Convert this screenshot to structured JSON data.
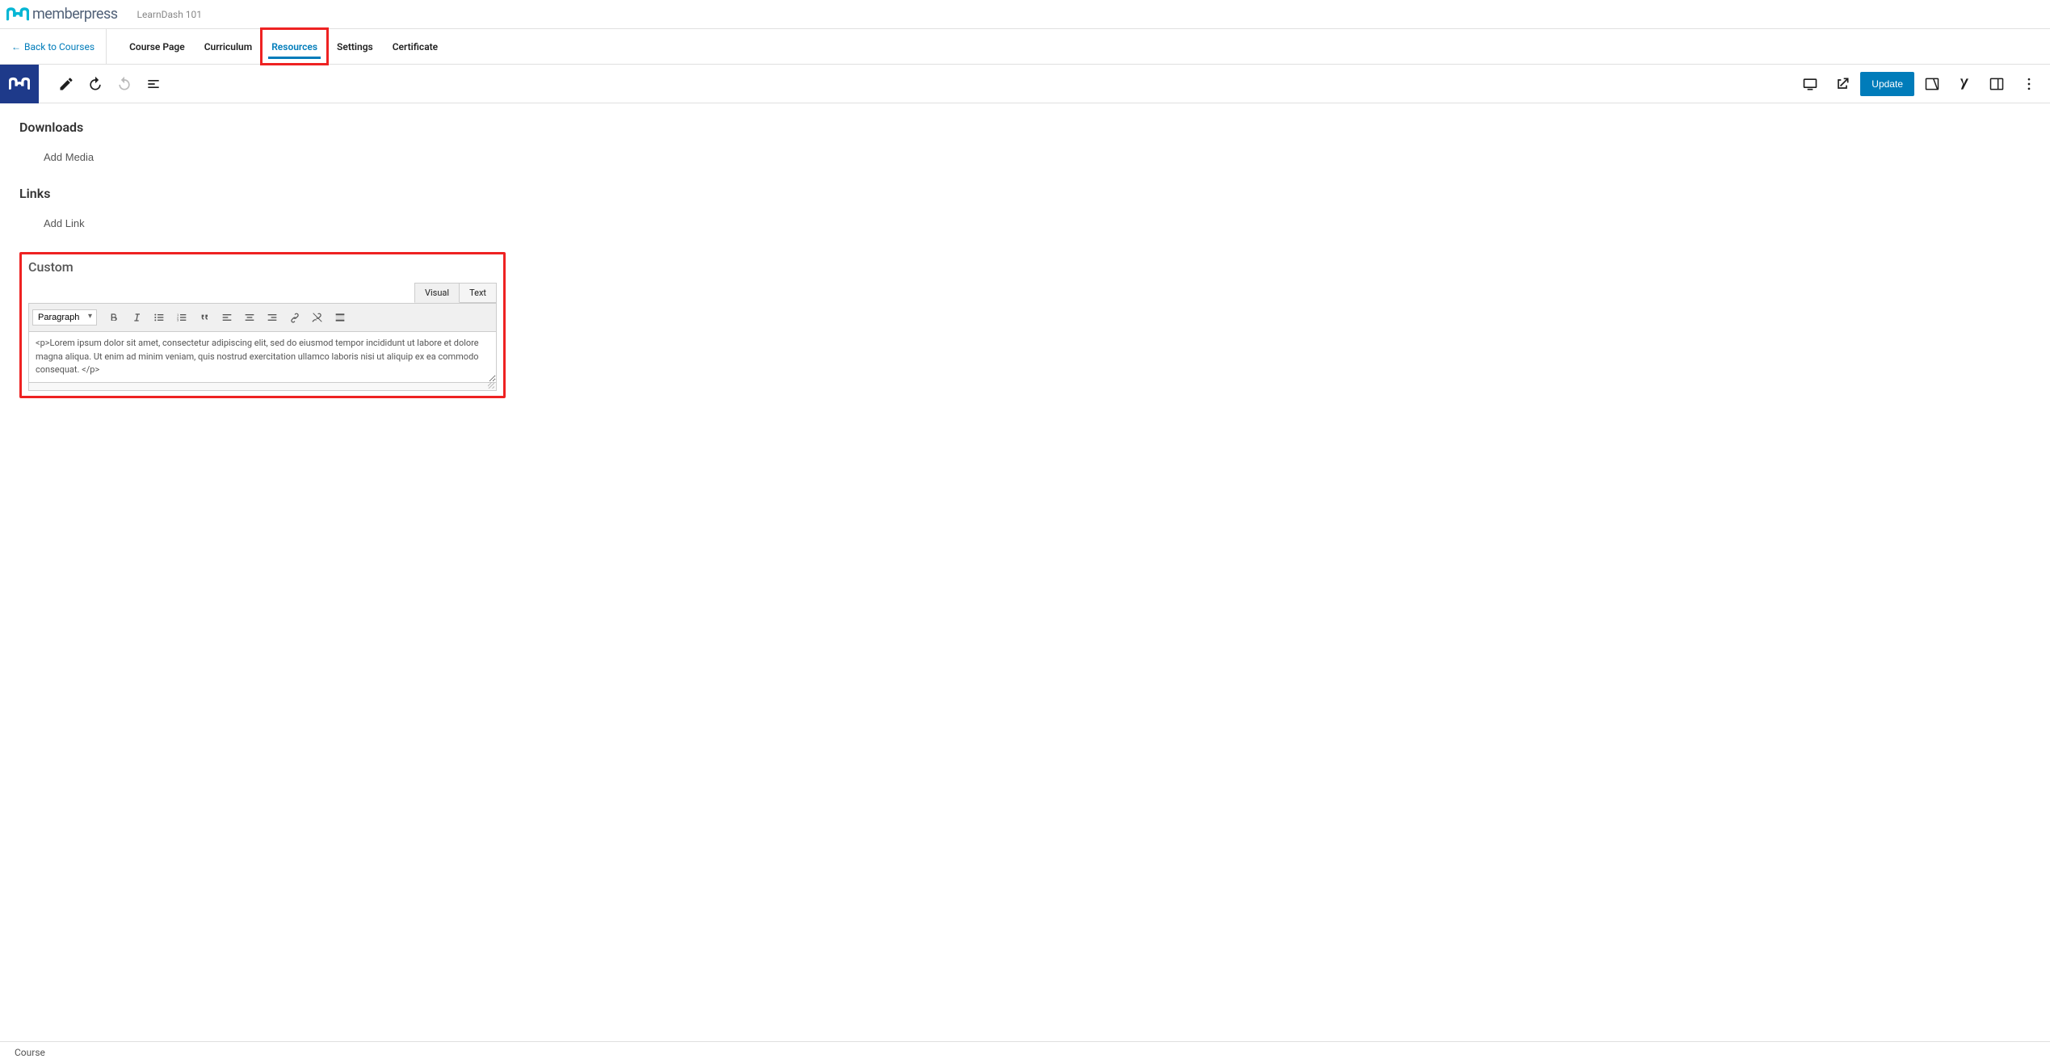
{
  "header": {
    "brand": "memberpress",
    "breadcrumb": "LearnDash 101"
  },
  "nav": {
    "back_label": "Back to Courses",
    "tabs": [
      {
        "label": "Course Page",
        "active": false
      },
      {
        "label": "Curriculum",
        "active": false
      },
      {
        "label": "Resources",
        "active": true
      },
      {
        "label": "Settings",
        "active": false
      },
      {
        "label": "Certificate",
        "active": false
      }
    ]
  },
  "editor_bar": {
    "update_label": "Update"
  },
  "sections": {
    "downloads": {
      "title": "Downloads",
      "add_label": "Add Media"
    },
    "links": {
      "title": "Links",
      "add_label": "Add Link"
    },
    "custom": {
      "title": "Custom",
      "tabs": {
        "visual": "Visual",
        "text": "Text"
      },
      "format_selected": "Paragraph",
      "content": "<p>Lorem ipsum dolor sit amet, consectetur adipiscing elit, sed do eiusmod tempor incididunt ut labore et dolore magna aliqua. Ut enim ad minim veniam, quis nostrud exercitation ullamco laboris nisi ut aliquip ex ea commodo consequat. </p>"
    }
  },
  "footer": {
    "label": "Course"
  }
}
